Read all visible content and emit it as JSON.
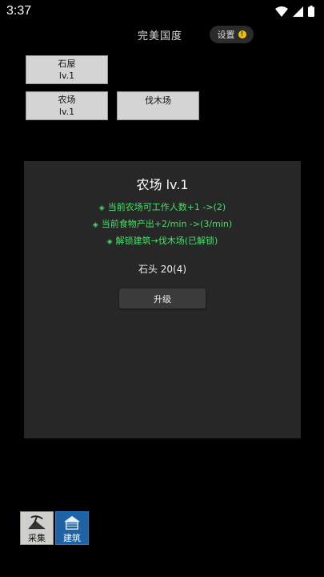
{
  "status": {
    "time": "3:37"
  },
  "header": {
    "title": "完美国度",
    "settings_label": "设置",
    "settings_badge": "!"
  },
  "buildings": [
    {
      "name": "石屋",
      "level": "lv.1"
    },
    {
      "name": "农场",
      "level": "lv.1"
    },
    {
      "name": "伐木场",
      "level": ""
    }
  ],
  "detail": {
    "title": "农场 lv.1",
    "effects": [
      "当前农场可工作人数+1 ->(2)",
      "当前食物产出+2/min ->(3/min)",
      "解锁建筑→伐木场(已解锁)"
    ],
    "bullet": "◈",
    "cost": "石头 20(4)",
    "upgrade_label": "升级"
  },
  "nav": {
    "gather_label": "采集",
    "build_label": "建筑"
  },
  "colors": {
    "effect_green": "#48e06a",
    "build_tab_blue": "#1f63a5"
  }
}
